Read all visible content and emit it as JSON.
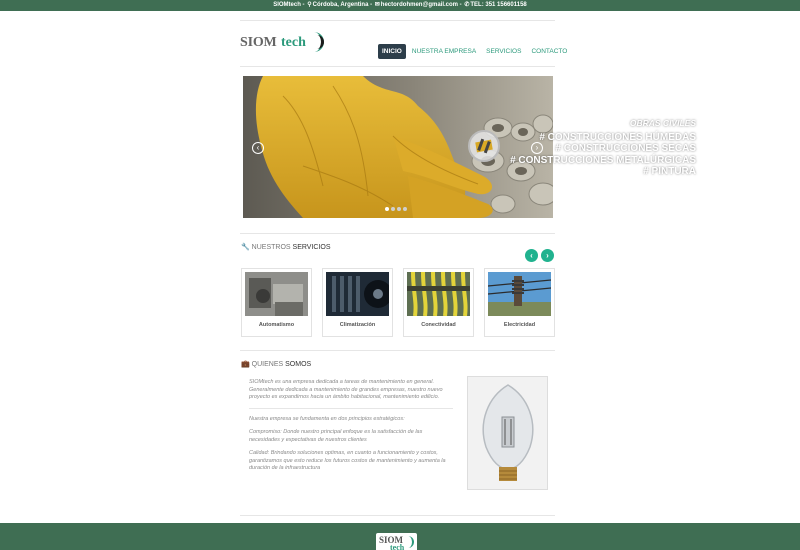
{
  "topbar": {
    "brand": "SIOMtech",
    "location": "Córdoba, Argentina",
    "email": "hectordohmen@gmail.com",
    "phone": "TEL: 351 156601158",
    "sep": " - "
  },
  "logo": {
    "part1": "SIOM",
    "part2": "tech"
  },
  "nav": {
    "items": [
      "INICIO",
      "NUESTRA EMPRESA",
      "SERVICIOS",
      "CONTACTO"
    ],
    "active": "INICIO"
  },
  "slider": {
    "title": "OBRAS CIVILES",
    "lines": [
      "# CONSTRUCCIONES HÚMEDAS",
      "# CONSTRUCCIONES SECAS",
      "# CONSTRUCCIONES METALÚRGICAS",
      "# PINTURA"
    ],
    "prev": "‹",
    "next": "›",
    "slides_total": 4,
    "slide_active": 1
  },
  "services": {
    "heading_light": "NUESTROS",
    "heading_bold": "SERVICIOS",
    "prev": "‹",
    "next": "›",
    "items": [
      "Automatismo",
      "Climatización",
      "Conectividad",
      "Electricidad"
    ]
  },
  "about": {
    "heading_light": "QUIENES",
    "heading_bold": "SOMOS",
    "p1": "SIOMtech es una empresa dedicada a tareas de mantenimiento en general. Generalmente dedicada a mantenimiento de grandes empresas, nuestro nuevo proyecto es expandirnos hacia un ámbito habitacional, mantenimiento edilicio.",
    "p2": "Nuestra empresa se fundamenta en dos principios estratégicos:",
    "p3": "Compromiso: Donde nuestro principal enfoque es la satisfacción de las necesidades y expectativas de nuestros clientes",
    "p4": "Calidad: Brindando soluciones optimas, en cuanto a funcionamiento y costos, garantizamos que esto reduce los futuros costos de mantenimiento y aumenta la duración de la infraestructura"
  },
  "colors": {
    "brand_green": "#3f6e53",
    "accent_teal": "#21b28f",
    "nav_active": "#2d3e4a",
    "glove_yellow": "#d9a925"
  },
  "icons": {
    "location": "map-pin-icon",
    "email": "envelope-icon",
    "phone": "phone-icon",
    "services": "wrench-icon",
    "about": "briefcase-icon"
  }
}
